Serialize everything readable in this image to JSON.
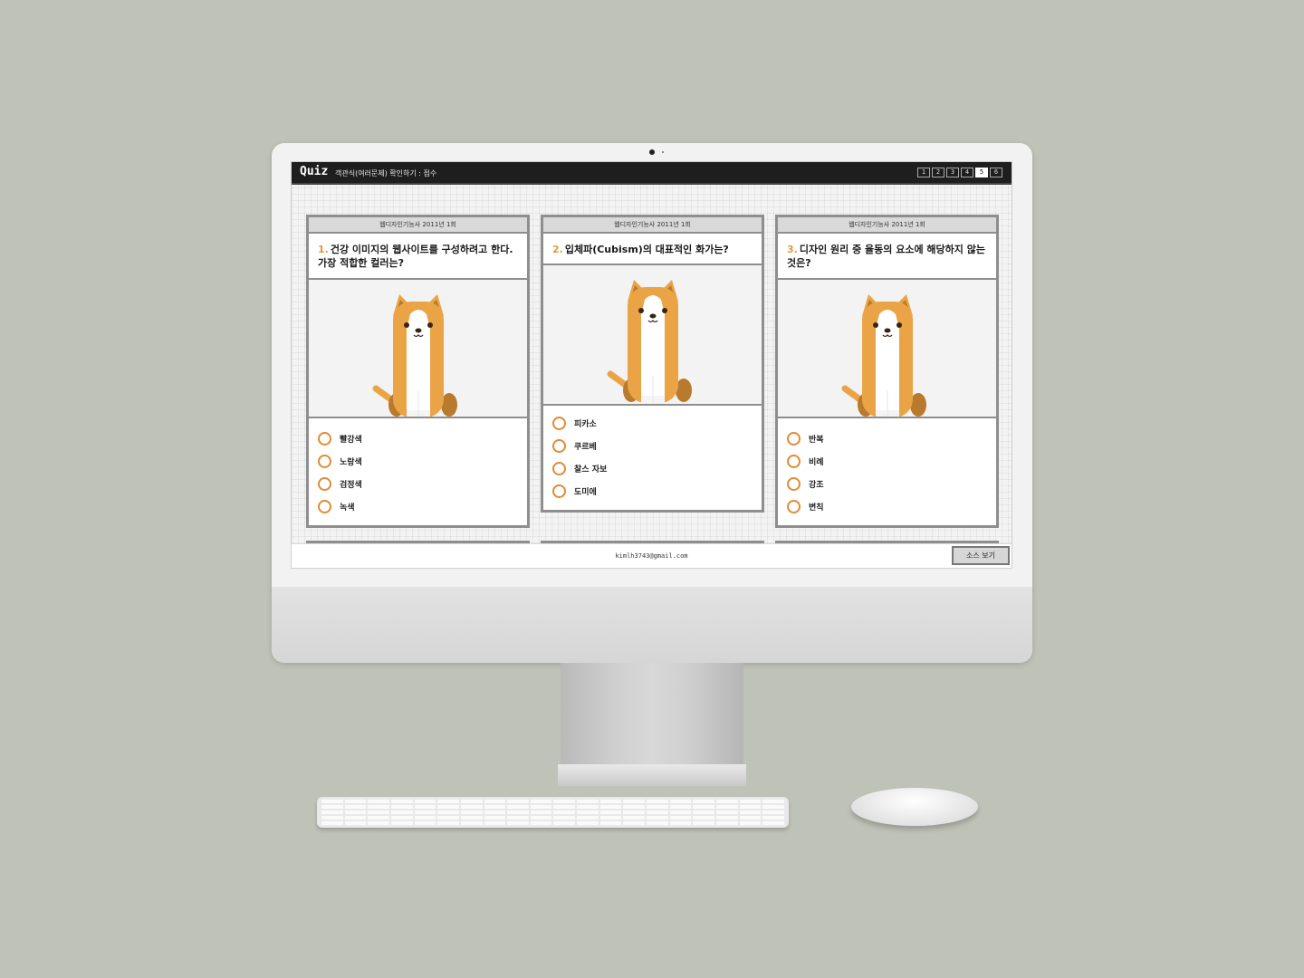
{
  "app": {
    "brand": "Quiz",
    "subtitle": "객관식(여러문제) 확인하기 : 점수"
  },
  "pagination": [
    "1",
    "2",
    "3",
    "4",
    "5",
    "6"
  ],
  "pagination_active": "5",
  "cards": [
    {
      "source": "웹디자인기능사 2011년 1회",
      "number": "1.",
      "question": "건강 이미지의 웹사이트를 구성하려고 한다. 가장 적합한 컬러는?",
      "options": [
        "빨강색",
        "노랑색",
        "검정색",
        "녹색"
      ]
    },
    {
      "source": "웹디자인기능사 2011년 1회",
      "number": "2.",
      "question": "입체파(Cubism)의 대표적인 화가는?",
      "options": [
        "피카소",
        "쿠르베",
        "찰스 자보",
        "도미에"
      ]
    },
    {
      "source": "웹디자인기능사 2011년 1회",
      "number": "3.",
      "question": "디자인 원리 중 율동의 요소에 해당하지 않는 것은?",
      "options": [
        "반복",
        "비례",
        "강조",
        "변칙"
      ]
    }
  ],
  "footer": {
    "email": "kimlh3743@gmail.com",
    "source_button": "소스 보기"
  },
  "colors": {
    "accent": "#e09a45",
    "dog_orange": "#eaa445",
    "topbar": "#1e1e1e"
  },
  "icons": {
    "mascot": "dog-mascot-icon",
    "radio": "radio-circle-icon"
  }
}
